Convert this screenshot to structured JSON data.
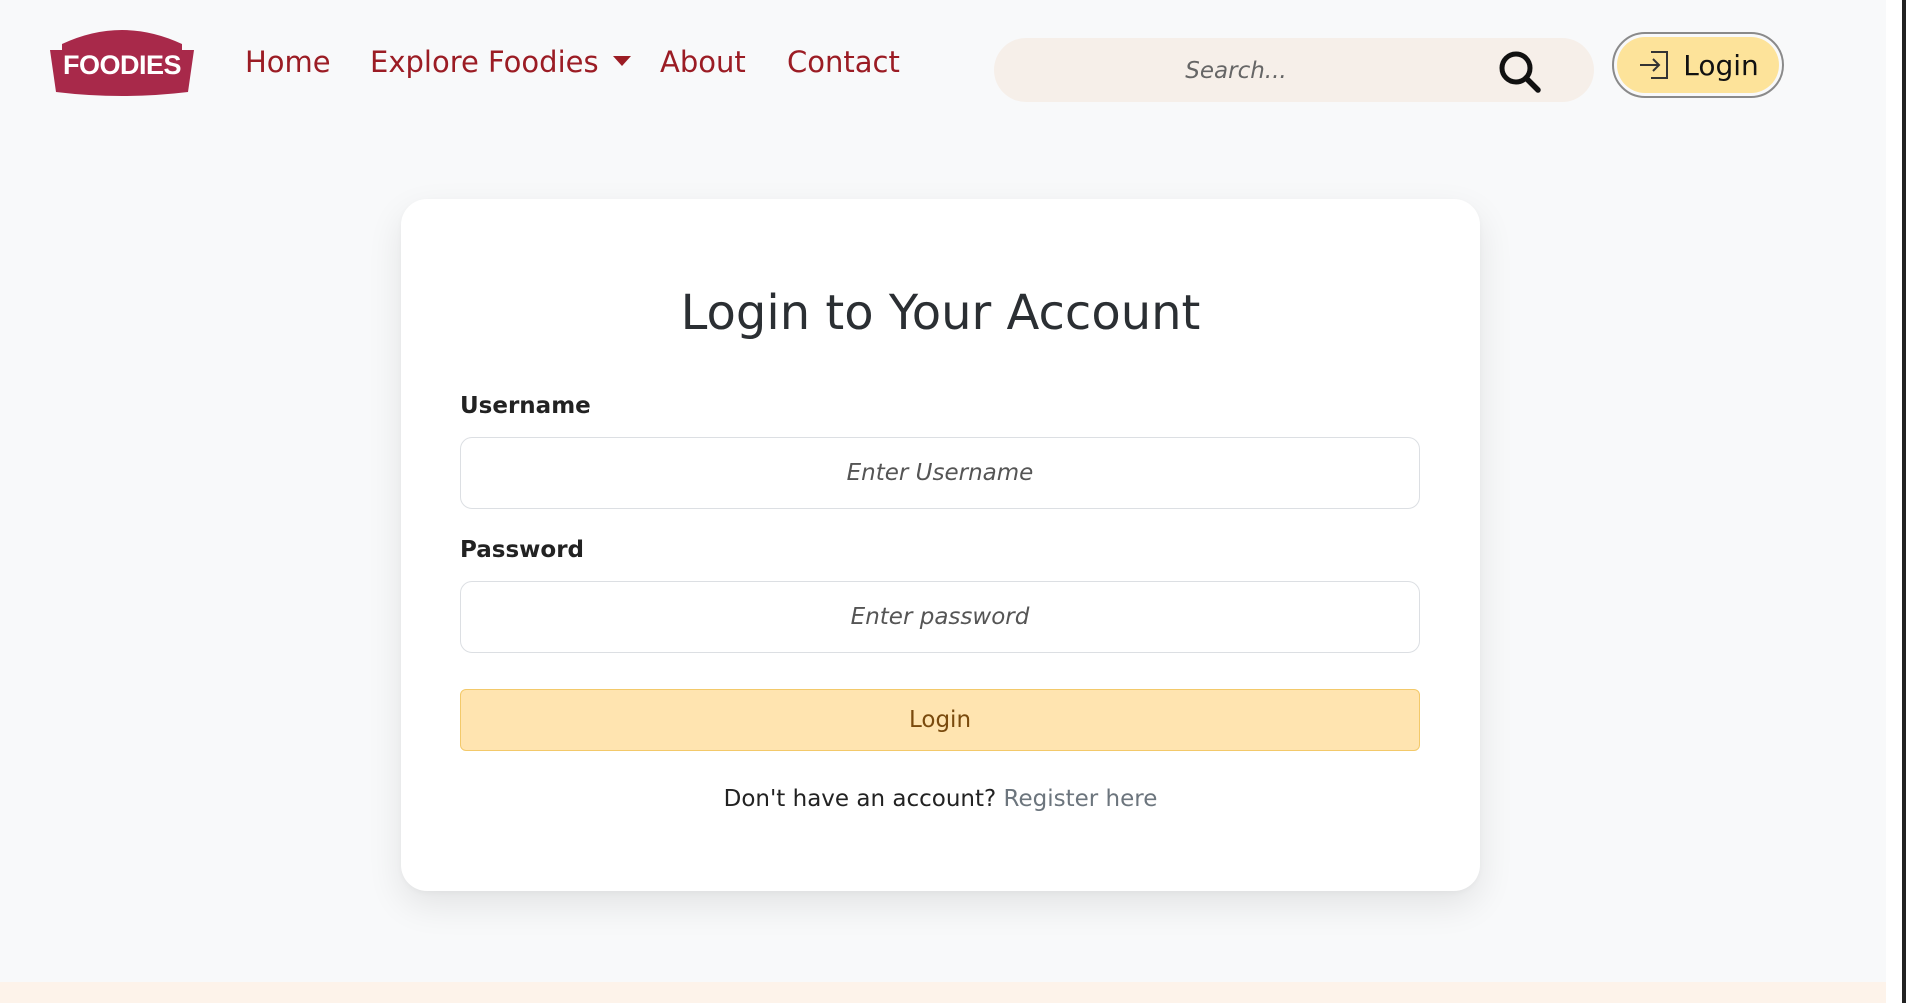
{
  "brand": {
    "logo_text": "FOODIES",
    "color": "#a8294a"
  },
  "nav": {
    "home": "Home",
    "explore": "Explore Foodies",
    "about": "About",
    "contact": "Contact",
    "link_color": "#9b1c24"
  },
  "search": {
    "placeholder": "Search...",
    "icon": "search-icon"
  },
  "header_login": {
    "label": "Login",
    "icon": "login-icon",
    "bg": "#fde39a"
  },
  "form": {
    "title": "Login to Your Account",
    "username_label": "Username",
    "username_placeholder": "Enter Username",
    "password_label": "Password",
    "password_placeholder": "Enter password",
    "submit_label": "Login",
    "register_prompt": "Don't have an account?",
    "register_link": "Register here"
  }
}
